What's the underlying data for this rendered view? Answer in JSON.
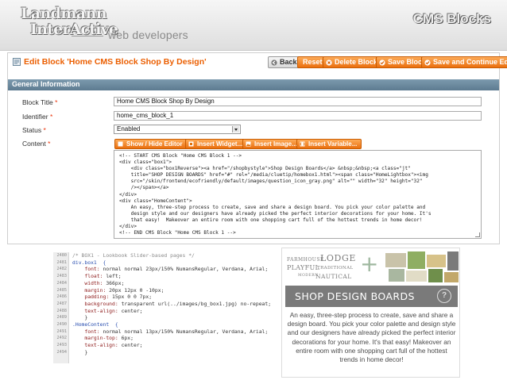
{
  "slide": {
    "logo_line1": "Landmann",
    "logo_line2": "InterActive",
    "tagline": "web developers",
    "title": "CMS Blocks"
  },
  "admin": {
    "page_title": "Edit Block 'Home CMS Block Shop By Design'",
    "buttons": {
      "back": "Back",
      "reset": "Reset",
      "delete": "Delete Block",
      "save": "Save Block",
      "save_continue": "Save and Continue Edit"
    },
    "section_title": "General Information",
    "fields": {
      "block_title_label": "Block Title",
      "block_title_value": "Home CMS Block Shop By Design",
      "identifier_label": "Identifier",
      "identifier_value": "home_cms_block_1",
      "status_label": "Status",
      "status_value": "Enabled",
      "content_label": "Content",
      "required_mark": "*"
    },
    "editor_buttons": {
      "toggle": "Show / Hide Editor",
      "widget": "Insert Widget...",
      "image": "Insert Image...",
      "variable": "Insert Variable..."
    },
    "content_lines": [
      "<!-- START CMS Block \"Home CMS Block 1 -->",
      "<div class=\"box1\">",
      "    <div class=\"box1Reverse\"><a href=\"/shopbystyle\">Shop Design Boards</a> &nbsp;&nbsp;<a class=\"jt\"",
      "    title=\"SHOP DESIGN BOARDS\" href=\"#\" rel=\"/media/cluetip/homebox1.html\"><span class=\"HomeLightbox\"><img",
      "    src=\"/skin/frontend/ecofriendly/default/images/question_icon_gray.png\" alt=\"\" width=\"32\" height=\"32\"",
      "    /></span></a>",
      "</div>",
      "<div class=\"HomeContent\">",
      "    An easy, three-step process to create, save and share a design board. You pick your color palette and",
      "    design style and our designers have already picked the perfect interior decorations for your home. It's",
      "    that easy!  Makeover an entire room with one shopping cart full of the hottest trends in home decor!",
      "</div>",
      "<!-- END CMS Block \"Home CMS Block 1 -->"
    ]
  },
  "css_code": {
    "line_numbers": [
      "2480",
      "2481",
      "2482",
      "2483",
      "2484",
      "2485",
      "2486",
      "2487",
      "2488",
      "2489",
      "2490",
      "2491",
      "2492",
      "2493",
      "2494"
    ],
    "lines": [
      {
        "kind": "comment",
        "text": "/* BOX1 - Lookbook Slider-based pages */"
      },
      {
        "kind": "selector",
        "text": "div.box1  {"
      },
      {
        "kind": "decl",
        "prop": "    font:",
        "val": " normal normal 23px/150% NumansRegular, Verdana, Arial;"
      },
      {
        "kind": "decl",
        "prop": "    float:",
        "val": " left;"
      },
      {
        "kind": "decl",
        "prop": "    width:",
        "val": " 366px;"
      },
      {
        "kind": "decl",
        "prop": "    margin:",
        "val": " 20px 12px 0 -10px;"
      },
      {
        "kind": "decl",
        "prop": "    padding:",
        "val": " 15px 0 0 7px;"
      },
      {
        "kind": "decl",
        "prop": "    background:",
        "val": " transparent url(../images/bg_box1.jpg) no-repeat;"
      },
      {
        "kind": "decl",
        "prop": "    text-align:",
        "val": " center;"
      },
      {
        "kind": "plain",
        "text": "    }"
      },
      {
        "kind": "selector",
        "text": ".HomeContent  {"
      },
      {
        "kind": "decl",
        "prop": "    font:",
        "val": " normal normal 13px/150% NumansRegular, Verdana, Arial;"
      },
      {
        "kind": "decl",
        "prop": "    margin-top:",
        "val": " 6px;"
      },
      {
        "kind": "decl",
        "prop": "    text-align:",
        "val": " center;"
      },
      {
        "kind": "plain",
        "text": "    }"
      }
    ]
  },
  "widget": {
    "style_words": {
      "farmhouse": "FARMHOUSE",
      "lodge": "LODGE",
      "playful": "PLAYFUL",
      "traditional": "TRADITIONAL",
      "modern": "MODERN",
      "nautical": "NAUTICAL"
    },
    "plus": "+",
    "band_title": "SHOP DESIGN BOARDS",
    "help_glyph": "?",
    "description": "An easy, three-step process to create, save and share a design board. You pick your color palette and design style and our designers have already picked the perfect interior decorations for your home. It's that easy! Makeover an entire room with one shopping cart full of the hottest trends in home decor!",
    "swatch_colors": [
      "#c9c3a9",
      "#8fae62",
      "#d7c289",
      "#7a7a7a",
      "#a9b7a0",
      "#e1dcc6",
      "#6f8f4b",
      "#c2a86a"
    ]
  },
  "colors": {
    "magento_orange": "#eb5e00",
    "section_bar": "#6b889c"
  }
}
